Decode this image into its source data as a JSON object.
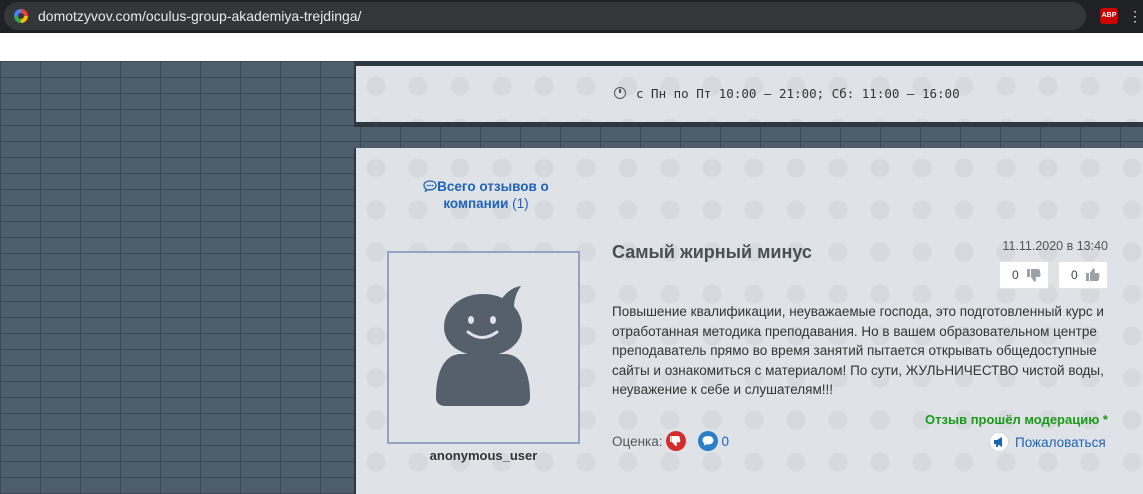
{
  "browser": {
    "url": "domotzyvov.com/oculus-group-akademiya-trejdinga/",
    "extension_label": "ABP",
    "menu_glyph": "⋮"
  },
  "company": {
    "hours_text": "с Пн по Пт 10:00 – 21:00; Сб: 11:00 – 16:00"
  },
  "reviews_summary": {
    "label": "Всего отзывов о компании",
    "count": "(1)"
  },
  "review": {
    "author": "anonymous_user",
    "title": "Самый жирный минус",
    "date": "11.11.2020 в 13:40",
    "dislikes": "0",
    "likes": "0",
    "text": "Повышение квалификации, неуважаемые господа, это подготовленный курс и отработанная методика преподавания. Но в вашем образовательном центре преподаватель прямо во время занятий пытается открывать общедоступные сайты и ознакомиться с материалом! По сути, ЖУЛЬНИЧЕСТВО чистой воды, неуважение к себе и слушателям!!!",
    "moderation_status": "Отзыв прошёл модерацию *",
    "rating_label": "Оценка:",
    "comments_count": "0",
    "complain_label": "Пожаловаться"
  },
  "colors": {
    "link": "#1f63b5",
    "moderation_green": "#1a9a1a",
    "dislike_red": "#d42b2b",
    "avatar_gray": "#56606c"
  },
  "icons": [
    "google-favicon-icon",
    "clock-icon",
    "chat-bubble-icon",
    "avatar-icon",
    "thumb-down-icon",
    "thumb-up-icon",
    "comment-icon",
    "megaphone-icon"
  ]
}
